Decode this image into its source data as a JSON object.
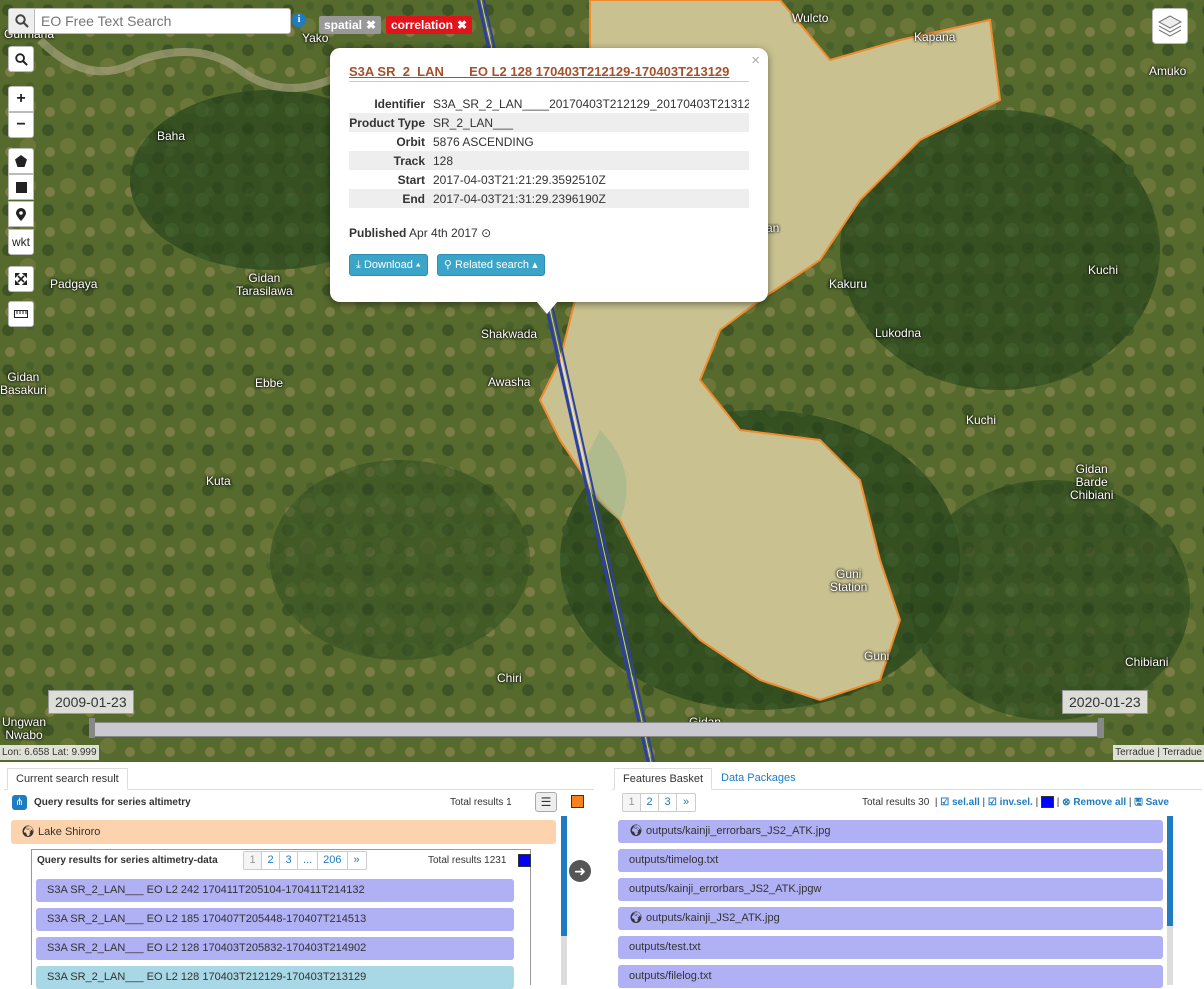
{
  "search": {
    "placeholder": "EO Free Text Search"
  },
  "chips": [
    {
      "label": "spatial",
      "color": "#999999"
    },
    {
      "label": "correlation",
      "color": "#e0141a"
    }
  ],
  "toolbar": {
    "wkt_label": "wkt"
  },
  "places": {
    "gurmana": "Gurmana",
    "yako": "Yako",
    "baha": "Baha",
    "padgaya": "Padgaya",
    "gidan_tarasilawa": "Gidan\nTarasilawa",
    "gidan_basakuri": "Gidan\nBasakuri",
    "ebbe": "Ebbe",
    "kuta": "Kuta",
    "shakwada": "Shakwada",
    "awasha": "Awasha",
    "chiri": "Chiri",
    "ungwan_nwabo": "Ungwan\nNwabo",
    "gidan": "Gidan",
    "wulcto": "Wulcto",
    "kapana": "Kapana",
    "amuko": "Amuko",
    "kakuru": "Kakuru",
    "lukodna": "Lukodna",
    "kuchi1": "Kuchi",
    "kuchi2": "Kuchi",
    "gidan_barde": "Gidan\nBarde\nChibiani",
    "guni_station": "Guni\nStation",
    "guni": "Guni",
    "chibiani": "Chibiani",
    "jan": "an"
  },
  "popup": {
    "title": "S3A SR_2_LAN___ EO L2 128 170403T212129-170403T213129",
    "rows": [
      {
        "key": "Identifier",
        "value": "S3A_SR_2_LAN____20170403T212129_20170403T213129"
      },
      {
        "key": "Product Type",
        "value": "SR_2_LAN___"
      },
      {
        "key": "Orbit",
        "value": "5876 ASCENDING"
      },
      {
        "key": "Track",
        "value": "128"
      },
      {
        "key": "Start",
        "value": "2017-04-03T21:21:29.3592510Z"
      },
      {
        "key": "End",
        "value": "2017-04-03T21:31:29.2396190Z"
      }
    ],
    "published_label": "Published",
    "published_value": "Apr 4th 2017",
    "download_label": "Download",
    "related_label": "Related search"
  },
  "timeline": {
    "start": "2009-01-23",
    "end": "2020-01-23"
  },
  "coords": "Lon: 6.658 Lat: 9.999",
  "attribution": "Terradue | Terradue",
  "left_panel": {
    "tab_label": "Current search result",
    "query_title": "Query results for series altimetry",
    "total_label": "Total results",
    "total_value": "1",
    "series_color": "#f58220",
    "lake_label": "Lake Shiroro",
    "inner": {
      "title": "Query results for series altimetry-data",
      "pages": [
        "1",
        "2",
        "3",
        "...",
        "206",
        "»"
      ],
      "total_label": "Total results",
      "total_value": "1231",
      "series_color": "#0000ff",
      "rows": [
        "S3A SR_2_LAN___ EO L2 242 170411T205104-170411T214132",
        "S3A SR_2_LAN___ EO L2 185 170407T205448-170407T214513",
        "S3A SR_2_LAN___ EO L2 128 170403T205832-170403T214902",
        "S3A SR_2_LAN___ EO L2 128 170403T212129-170403T213129"
      ]
    }
  },
  "right_panel": {
    "tab_basket": "Features Basket",
    "tab_packages": "Data Packages",
    "pages": [
      "1",
      "2",
      "3",
      "»"
    ],
    "total_label": "Total results",
    "total_value": "30",
    "sel_all": "sel.all",
    "inv_sel": "inv.sel.",
    "remove_all": "Remove all",
    "save": "Save",
    "basket_color": "#0000ff",
    "rows": [
      {
        "label": "outputs/kainji_errorbars_JS2_ATK.jpg",
        "globe": true
      },
      {
        "label": "outputs/timelog.txt",
        "globe": false
      },
      {
        "label": "outputs/kainji_errorbars_JS2_ATK.jpgw",
        "globe": false
      },
      {
        "label": "outputs/kainji_JS2_ATK.jpg",
        "globe": true
      },
      {
        "label": "outputs/test.txt",
        "globe": false
      },
      {
        "label": "outputs/filelog.txt",
        "globe": false
      }
    ]
  }
}
